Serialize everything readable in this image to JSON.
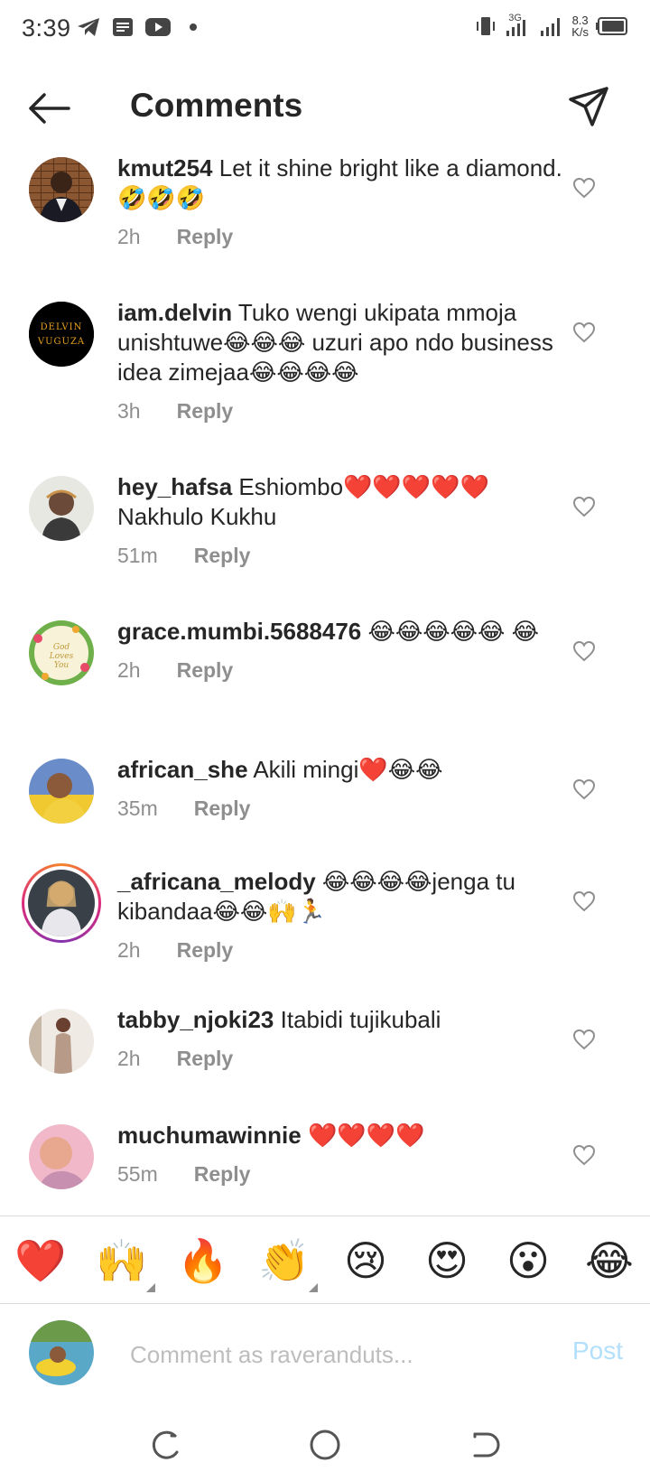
{
  "status_bar": {
    "time": "3:39",
    "network": "3G",
    "speed_value": "8.3",
    "speed_unit": "K/s"
  },
  "header": {
    "title": "Comments"
  },
  "comments": [
    {
      "username": "kmut254",
      "text": "Let it shine bright like a diamond. 🤣🤣🤣",
      "time": "2h",
      "reply": "Reply"
    },
    {
      "username": "iam.delvin",
      "text": "Tuko wengi ukipata mmoja unishtuwe😂😂😂 uzuri apo ndo business idea zimejaa😂😂😂😂",
      "time": "3h",
      "reply": "Reply",
      "avatar_text": "DELVIN VUGUZA"
    },
    {
      "username": "hey_hafsa",
      "text": "Eshiombo❤️❤️❤️❤️❤️ Nakhulo Kukhu",
      "time": "51m",
      "reply": "Reply"
    },
    {
      "username": "grace.mumbi.5688476",
      "text": "😂😂😂😂😂 😂",
      "time": "2h",
      "reply": "Reply",
      "avatar_text": "God Loves You"
    },
    {
      "username": "african_she",
      "text": "Akili mingi❤️😂😂",
      "time": "35m",
      "reply": "Reply"
    },
    {
      "username": "_africana_melody",
      "text": "😂😂😂😂jenga tu kibandaa😂😂🙌🏃",
      "time": "2h",
      "reply": "Reply"
    },
    {
      "username": "tabby_njoki23",
      "text": "Itabidi tujikubali",
      "time": "2h",
      "reply": "Reply"
    },
    {
      "username": "muchumawinnie",
      "text": "❤️❤️❤️❤️",
      "time": "55m",
      "reply": "Reply"
    }
  ],
  "emoji_bar": [
    "❤️",
    "🙌",
    "🔥",
    "👏",
    "😢",
    "😍",
    "😮",
    "😂"
  ],
  "compose": {
    "placeholder": "Comment as raveranduts...",
    "post_label": "Post"
  },
  "colors": {
    "text": "#262626",
    "meta": "#8e8e8e",
    "post_disabled": "#b2dffc",
    "story_ring": "#dd2a7b"
  }
}
